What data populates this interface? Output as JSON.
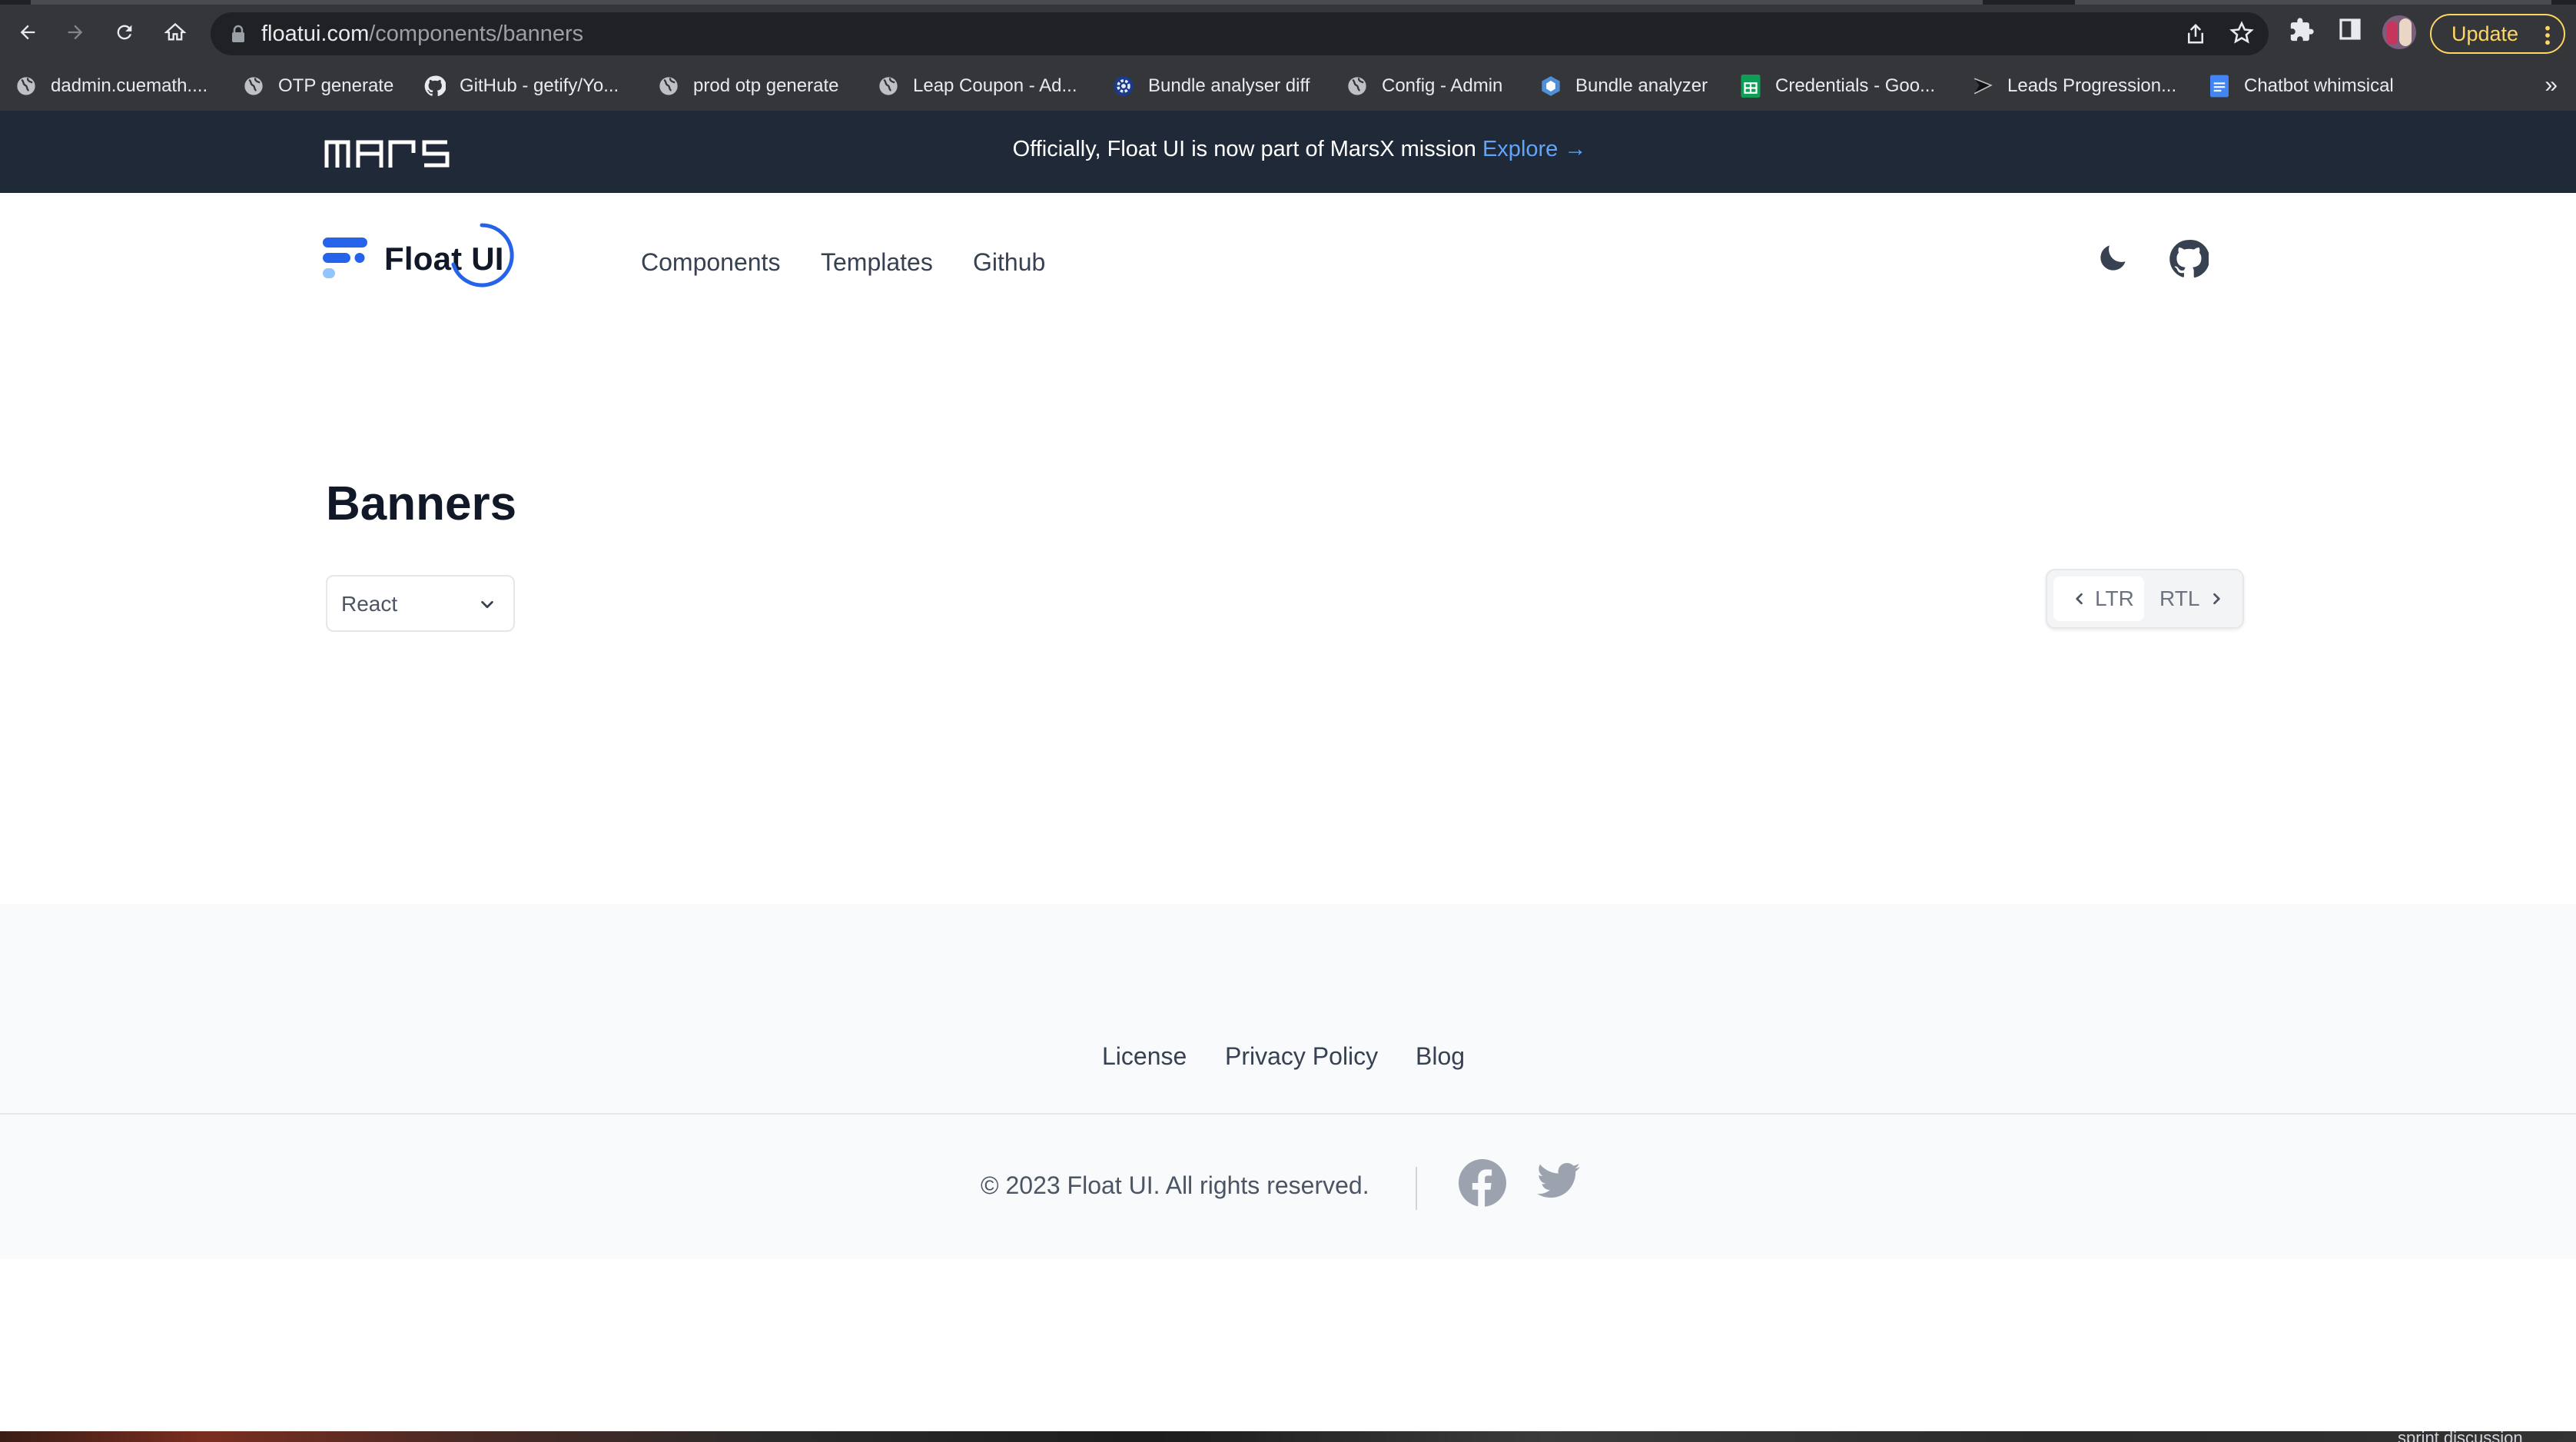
{
  "browser": {
    "url_host": "floatui.com",
    "url_path": "/components/banners",
    "update_label": "Update",
    "bookmarks": [
      {
        "label": "dadmin.cuemath....",
        "icon": "globe-icon"
      },
      {
        "label": "OTP generate",
        "icon": "globe-icon"
      },
      {
        "label": "GitHub - getify/Yo...",
        "icon": "github-icon"
      },
      {
        "label": "prod otp generate",
        "icon": "globe-icon"
      },
      {
        "label": "Leap Coupon - Ad...",
        "icon": "globe-icon"
      },
      {
        "label": "Bundle analyser diff",
        "icon": "gear-icon"
      },
      {
        "label": "Config - Admin",
        "icon": "globe-icon"
      },
      {
        "label": "Bundle analyzer",
        "icon": "cube-icon"
      },
      {
        "label": "Credentials - Goo...",
        "icon": "sheets-icon"
      },
      {
        "label": "Leads Progression...",
        "icon": "flag-icon"
      },
      {
        "label": "Chatbot whimsical",
        "icon": "doc-icon"
      }
    ],
    "bookmarks_overflow": "»"
  },
  "announcement": {
    "logo_text": "MARS",
    "text": "Officially, Float UI is now part of MarsX mission",
    "link": "Explore →"
  },
  "header": {
    "brand": "Float UI",
    "nav": [
      "Components",
      "Templates",
      "Github"
    ],
    "icons": [
      "moon-icon",
      "github-icon"
    ]
  },
  "main": {
    "title": "Banners",
    "framework_select": "React",
    "direction": {
      "ltr": "LTR",
      "rtl": "RTL",
      "active": "LTR"
    }
  },
  "footer": {
    "links": [
      "License",
      "Privacy Policy",
      "Blog"
    ],
    "copyright": "© 2023 Float UI. All rights reserved.",
    "social": [
      "facebook-icon",
      "twitter-icon"
    ]
  },
  "desktop": {
    "label": "sprint discussion"
  },
  "colors": {
    "announcement_bg": "#1f2937",
    "link_blue": "#60a5fa",
    "brand_blue": "#2563eb",
    "footer_bg": "#f8fafc",
    "chrome_bg": "#35363a",
    "update_yellow": "#fdd663"
  }
}
